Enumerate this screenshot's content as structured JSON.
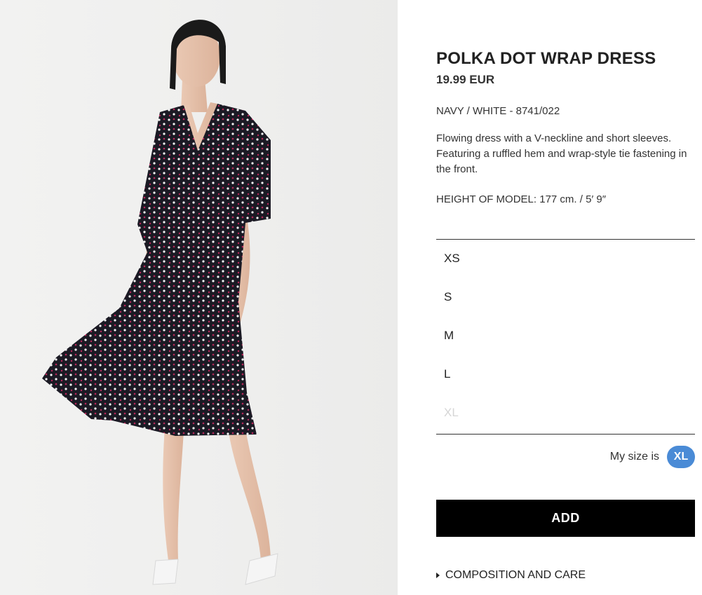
{
  "product": {
    "title": "POLKA DOT WRAP DRESS",
    "price": "19.99 EUR",
    "color_ref": "NAVY / WHITE - 8741/022",
    "description": "Flowing dress with a V-neckline and short sleeves. Featuring a ruffled hem and wrap-style tie fastening in the front.",
    "model_height": "HEIGHT OF MODEL: 177 cm. / 5′ 9″"
  },
  "sizes": [
    {
      "label": "XS",
      "available": true
    },
    {
      "label": "S",
      "available": true
    },
    {
      "label": "M",
      "available": true
    },
    {
      "label": "L",
      "available": true
    },
    {
      "label": "XL",
      "available": false
    }
  ],
  "my_size": {
    "label": "My size is",
    "value": "XL"
  },
  "add_button_label": "ADD",
  "composition_label": "COMPOSITION AND CARE",
  "colors": {
    "badge": "#4a8bd6",
    "add_button_bg": "#000000",
    "dress": "#1b1a24",
    "dot_white": "#f4f4f4",
    "dot_red": "#b8265a",
    "unavailable_size": "#d6d6d6"
  },
  "icons": {
    "composition": "caret-right-icon"
  }
}
